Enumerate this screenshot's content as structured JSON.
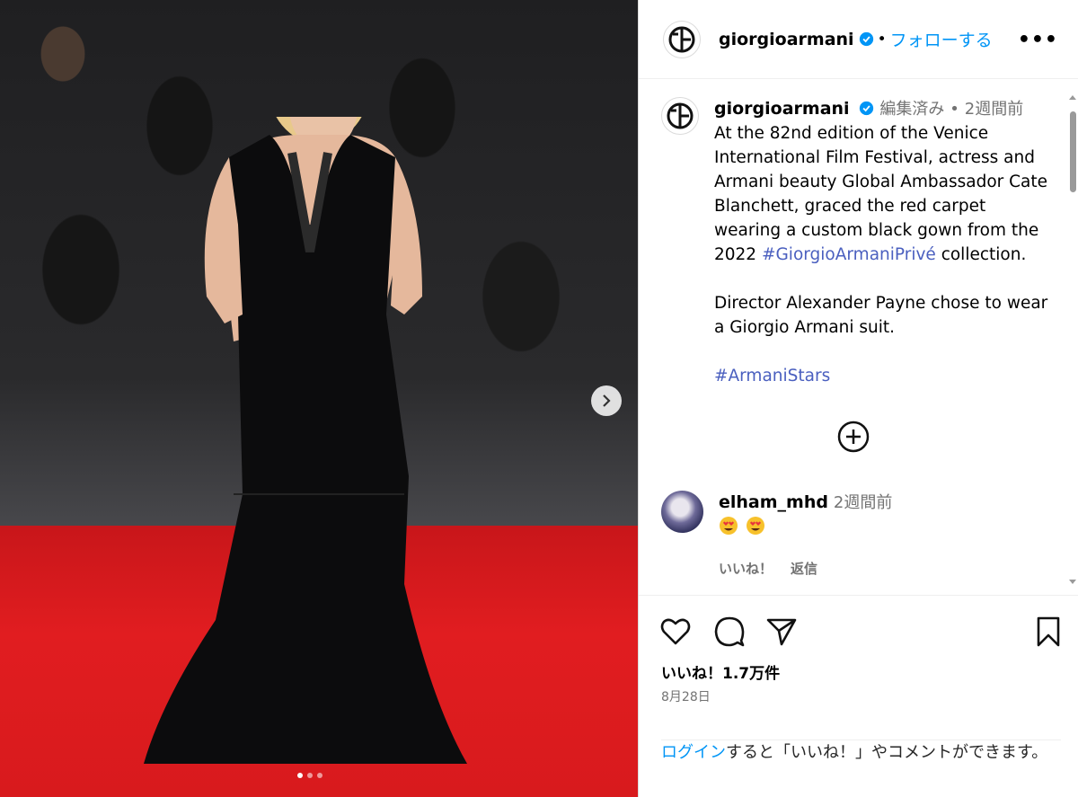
{
  "account": {
    "username": "giorgioarmani",
    "follow_separator": "•",
    "follow_label": "フォローする",
    "more_label": "•••"
  },
  "caption": {
    "username": "giorgioarmani",
    "edited": "編集済み",
    "separator": "•",
    "time": "2週間前",
    "paragraph1_pre": "At the 82nd edition of the Venice International Film Festival, actress and Armani beauty Global Ambassador Cate Blanchett, graced the red carpet wearing a custom black gown from the 2022 ",
    "paragraph1_hashtag": "#GiorgioArmaniPrivé",
    "paragraph1_post": " collection.",
    "paragraph2": "Director Alexander Payne chose to wear a Giorgio Armani suit.",
    "hashtag2": "#ArmaniStars"
  },
  "comment": {
    "username": "elham_mhd",
    "time": "2週間前",
    "emoji": "heart-eyes-emoji",
    "like_label": "いいね！",
    "reply_label": "返信"
  },
  "post": {
    "likes": "いいね！1.7万件",
    "date": "8月28日",
    "login_link": "ログイン",
    "login_text": "すると「いいね！」やコメントができます。"
  },
  "carousel": {
    "slide_count": 3,
    "active_index": 1
  },
  "colors": {
    "link_blue": "#0095f6",
    "hashtag_blue": "#4a5fbf",
    "carpet_red": "#e01c1c",
    "verified_blue": "#0095f6"
  }
}
